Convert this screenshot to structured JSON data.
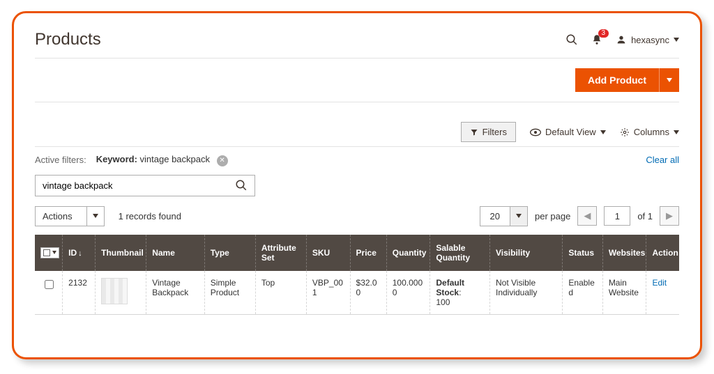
{
  "header": {
    "title": "Products",
    "notification_count": "3",
    "username": "hexasync"
  },
  "actionbar": {
    "add_product": "Add Product"
  },
  "toolbar": {
    "filters": "Filters",
    "default_view": "Default View",
    "columns": "Columns"
  },
  "active_filters": {
    "label": "Active filters:",
    "chip_key": "Keyword:",
    "chip_value": "vintage backpack",
    "clear_all": "Clear all"
  },
  "search": {
    "value": "vintage backpack"
  },
  "grid_ctrl": {
    "actions_label": "Actions",
    "records_found": "1 records found",
    "page_size": "20",
    "per_page": "per page",
    "page_current": "1",
    "of_label": "of 1"
  },
  "columns": {
    "id": "ID",
    "thumbnail": "Thumbnail",
    "name": "Name",
    "type": "Type",
    "attr_set": "Attribute Set",
    "sku": "SKU",
    "price": "Price",
    "quantity": "Quantity",
    "salable": "Salable Quantity",
    "visibility": "Visibility",
    "status": "Status",
    "websites": "Websites",
    "action": "Action"
  },
  "rows": [
    {
      "id": "2132",
      "name": "Vintage Backpack",
      "type": "Simple Product",
      "attr_set": "Top",
      "sku": "VBP_001",
      "price": "$32.00",
      "quantity": "100.0000",
      "salable_label": "Default Stock",
      "salable_value": "100",
      "visibility": "Not Visible Individually",
      "status": "Enabled",
      "websites": "Main Website",
      "action": "Edit"
    }
  ]
}
